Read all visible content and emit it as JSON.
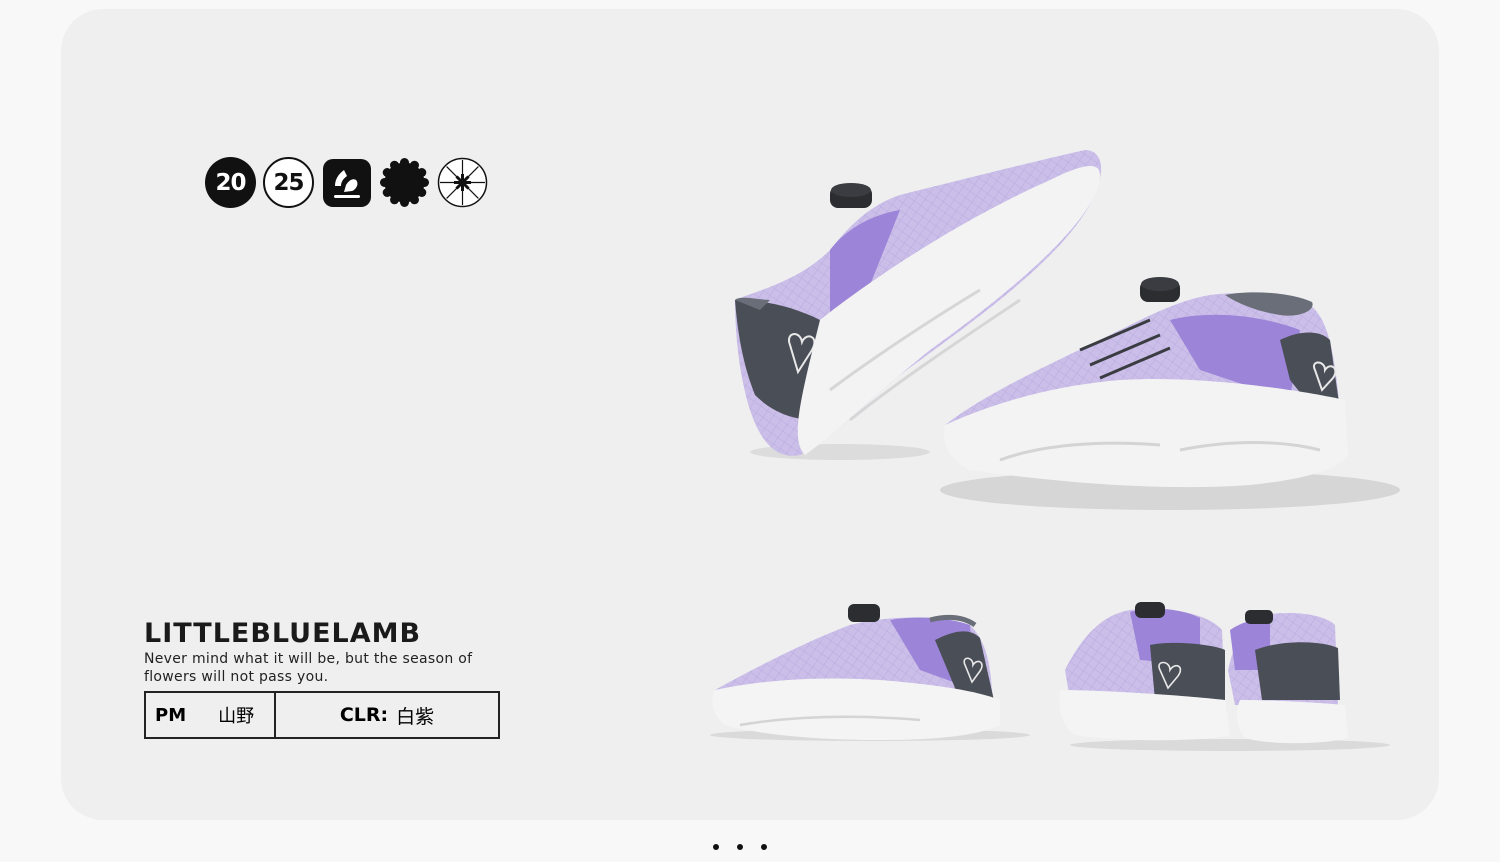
{
  "badges": {
    "year_left": "20",
    "year_right": "25",
    "icons": [
      "shoe-stamp-icon",
      "scalloped-seal-icon",
      "starburst-circle-icon"
    ]
  },
  "brand": {
    "name": "LITTLEBLUELAMB",
    "tagline": "Never mind what it will be, but the season of flowers will not pass you."
  },
  "spec": {
    "pm_label": "PM",
    "pm_value": "山野",
    "color_label": "CLR:",
    "color_value": "白紫"
  },
  "carousel": {
    "page_count": 3
  },
  "colors": {
    "background": "#f8f8f8",
    "card": "#efefef",
    "shoe_upper": "#c9bde8",
    "shoe_accent": "#9a82d6",
    "shoe_sole": "#f4f4f4",
    "shoe_heel": "#4a4e57"
  }
}
